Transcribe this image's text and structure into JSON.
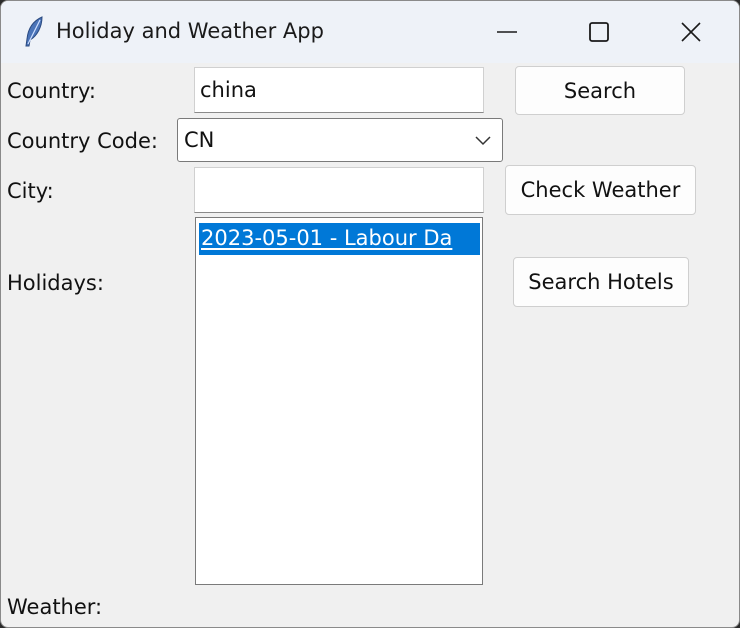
{
  "window": {
    "title": "Holiday and Weather App",
    "accent_color": "#0078d7"
  },
  "form": {
    "country_label": "Country:",
    "country_value": "china",
    "country_code_label": "Country Code:",
    "country_code_value": "CN",
    "city_label": "City:",
    "city_value": "",
    "holidays_label": "Holidays:",
    "weather_label": "Weather:"
  },
  "buttons": {
    "search": "Search",
    "check_weather": "Check Weather",
    "search_hotels": "Search Hotels"
  },
  "holidays": {
    "items": [
      "2023-05-01 - Labour Da"
    ],
    "selected_index": 0
  }
}
